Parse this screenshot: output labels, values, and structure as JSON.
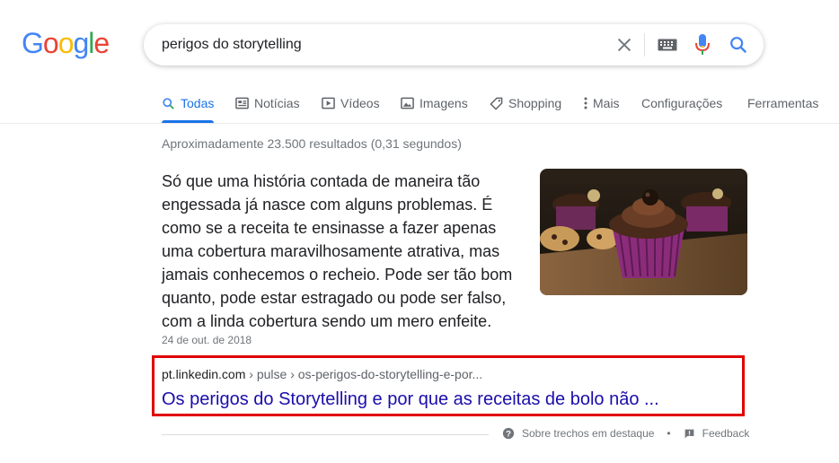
{
  "logo": {
    "letters": [
      "G",
      "o",
      "o",
      "g",
      "l",
      "e"
    ],
    "colors": [
      "#4285F4",
      "#EA4335",
      "#FBBC05",
      "#4285F4",
      "#34A853",
      "#EA4335"
    ]
  },
  "search": {
    "query": "perigos do storytelling"
  },
  "tabs": [
    {
      "label": "Todas",
      "icon": "search-icon",
      "active": true
    },
    {
      "label": "Notícias",
      "icon": "news-icon"
    },
    {
      "label": "Vídeos",
      "icon": "video-icon"
    },
    {
      "label": "Imagens",
      "icon": "image-icon"
    },
    {
      "label": "Shopping",
      "icon": "tag-icon"
    },
    {
      "label": "Mais",
      "icon": "more-vert-icon"
    },
    {
      "label": "Configurações"
    },
    {
      "label": "Ferramentas"
    }
  ],
  "stats": "Aproximadamente 23.500 resultados (0,31 segundos)",
  "featured": {
    "snippet": "Só que uma história contada de maneira tão engessada já nasce com alguns problemas. É como se a receita te ensinasse a fazer apenas uma cobertura maravilhosamente atrativa, mas jamais conhecemos o recheio. Pode ser tão bom quanto, pode estar estragado ou pode ser falso, com a linda cobertura sendo um mero enfeite.",
    "date": "24 de out. de 2018",
    "cite_domain": "pt.linkedin.com",
    "cite_path": " › pulse › os-perigos-do-storytelling-e-por...",
    "title": "Os perigos do Storytelling e por que as receitas de bolo não ...",
    "about_label": "Sobre trechos em destaque",
    "feedback_label": "Feedback"
  },
  "colors": {
    "accent": "#1a73e8",
    "link": "#1a0dab",
    "highlight_border": "#e00000"
  }
}
